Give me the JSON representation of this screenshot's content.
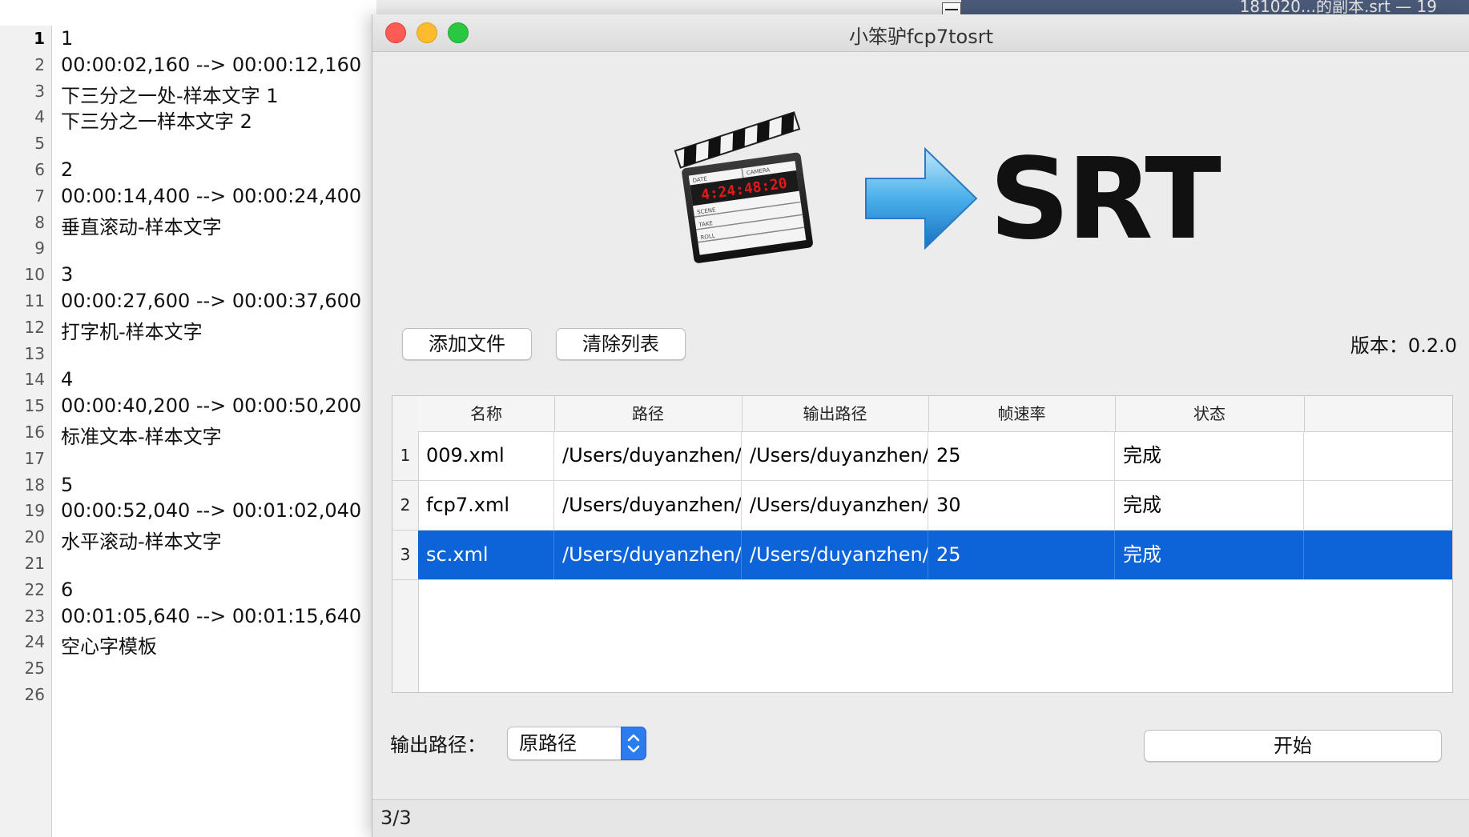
{
  "background_window": {
    "title_fragment": "181020...的副本.srt — 19"
  },
  "editor": {
    "line_numbers": [
      "1",
      "2",
      "3",
      "4",
      "5",
      "6",
      "7",
      "8",
      "9",
      "10",
      "11",
      "12",
      "13",
      "14",
      "15",
      "16",
      "17",
      "18",
      "19",
      "20",
      "21",
      "22",
      "23",
      "24",
      "25",
      "26"
    ],
    "current_line": 1,
    "lines": [
      "1",
      "00:00:02,160 --> 00:00:12,160",
      "下三分之一处-样本文字 1",
      "下三分之一样本文字 2",
      "",
      "2",
      "00:00:14,400 --> 00:00:24,400",
      "垂直滚动-样本文字",
      "",
      "3",
      "00:00:27,600 --> 00:00:37,600",
      "打字机-样本文字",
      "",
      "4",
      "00:00:40,200 --> 00:00:50,200",
      "标准文本-样本文字",
      "",
      "5",
      "00:00:52,040 --> 00:01:02,040",
      "水平滚动-样本文字",
      "",
      "6",
      "00:01:05,640 --> 00:01:15,640",
      "空心字模板",
      "",
      ""
    ]
  },
  "window": {
    "title": "小笨驴fcp7tosrt",
    "logo_text": "SRT",
    "clapper": {
      "date": "4:24:48:20",
      "labels": [
        "DATE",
        "CAMERA",
        "SCENE",
        "TAKE",
        "ROLL"
      ]
    }
  },
  "toolbar": {
    "add_label": "添加文件",
    "clear_label": "清除列表",
    "version_label": "版本：0.2.0"
  },
  "table": {
    "columns": [
      "名称",
      "路径",
      "输出路径",
      "帧速率",
      "状态"
    ],
    "rows": [
      {
        "num": "1",
        "name": "009.xml",
        "path": "/Users/duyanzhen/...",
        "out": "/Users/duyanzhen/...",
        "fps": "25",
        "status": "完成"
      },
      {
        "num": "2",
        "name": "fcp7.xml",
        "path": "/Users/duyanzhen/...",
        "out": "/Users/duyanzhen/...",
        "fps": "30",
        "status": "完成"
      },
      {
        "num": "3",
        "name": "sc.xml",
        "path": "/Users/duyanzhen/...",
        "out": "/Users/duyanzhen/...",
        "fps": "25",
        "status": "完成"
      }
    ],
    "selected_row": 3
  },
  "output": {
    "label": "输出路径：",
    "selected": "原路径"
  },
  "start_label": "开始",
  "status_text": "3/3",
  "colors": {
    "selection": "#0d63d8",
    "close": "#fd5c56",
    "minimize": "#fdbc2e",
    "maximize": "#29c840"
  }
}
